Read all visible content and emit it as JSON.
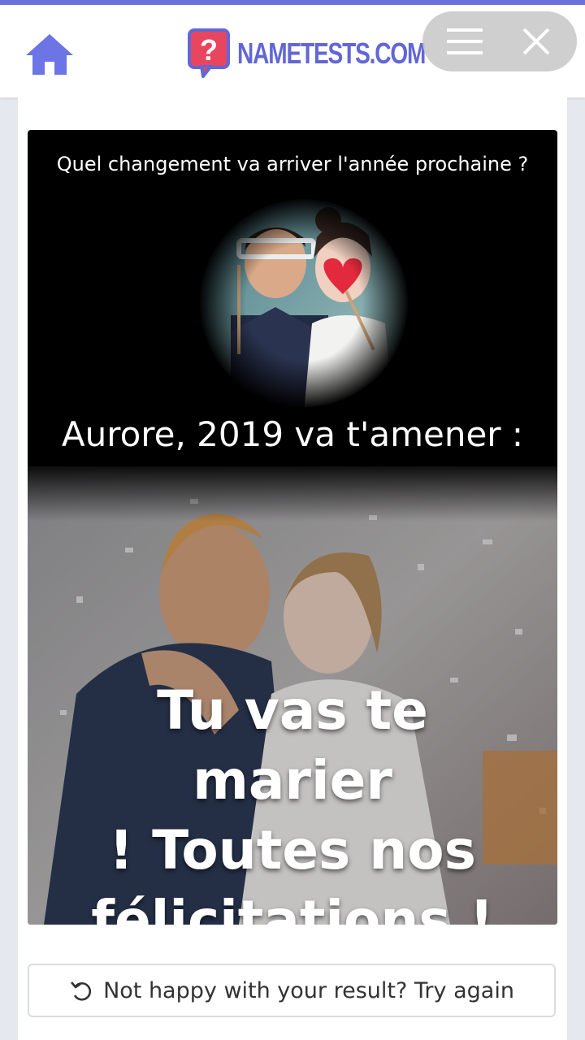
{
  "header": {
    "home_icon": "home-icon",
    "logo_mark": "?",
    "logo_text": "NAMETESTS.COM",
    "brand_color": "#6266d6",
    "logo_color": "#e8465e"
  },
  "browser_controls": {
    "menu_icon": "hamburger-menu-icon",
    "close_icon": "close-icon"
  },
  "result": {
    "question": "Quel changement va arriver l'année prochaine ?",
    "heading": "Aurore, 2019 va t'amener :",
    "result_lines": [
      "Tu vas te marier",
      "! Toutes nos",
      "félicitations !"
    ]
  },
  "retry": {
    "icon": "undo-icon",
    "label": "Not happy with your result? Try again"
  }
}
